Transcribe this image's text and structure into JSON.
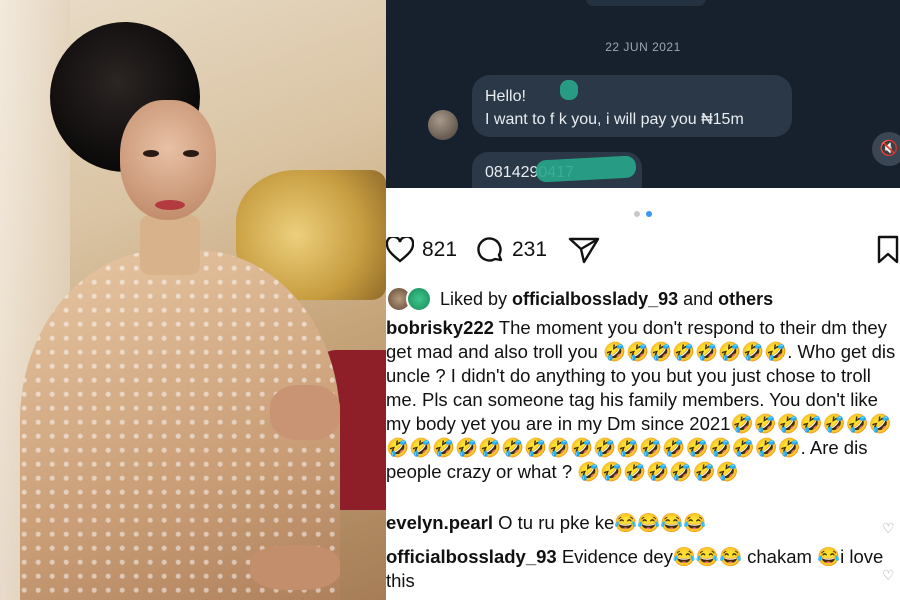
{
  "dm": {
    "date": "22 JUN 2021",
    "message1_line1": "Hello!",
    "message1_line2": "I want to f  k you, i will pay you ₦15m",
    "message2": "0814290417",
    "mute_icon": "speaker-mute-icon"
  },
  "post": {
    "likes_count": "821",
    "comments_count": "231",
    "liked_by_prefix": "Liked by ",
    "liked_by_user": "officialbosslady_93",
    "liked_by_suffix": " and ",
    "liked_by_others": "others"
  },
  "caption": {
    "username": "bobrisky222",
    "text": "The moment you don't respond to their dm they get mad and also troll you 🤣🤣🤣🤣🤣🤣🤣🤣. Who get dis uncle ? I didn't do anything to you but you just chose to troll me. Pls can someone tag his family members. You don't like my body yet you are in my Dm since 2021🤣🤣🤣🤣🤣🤣🤣🤣🤣🤣🤣🤣🤣🤣🤣🤣🤣🤣🤣🤣🤣🤣🤣🤣🤣. Are dis people crazy or what ? 🤣🤣🤣🤣🤣🤣🤣"
  },
  "comments": [
    {
      "username": "evelyn.pearl",
      "text": "O tu ru pke ke😂😂😂😂"
    },
    {
      "username": "officialbosslady_93",
      "text": "Evidence dey😂😂😂 chakam 😂i love this"
    }
  ],
  "colors": {
    "dm_background": "#17212e",
    "bubble": "#2a3847",
    "accent_blue": "#3897f0"
  }
}
